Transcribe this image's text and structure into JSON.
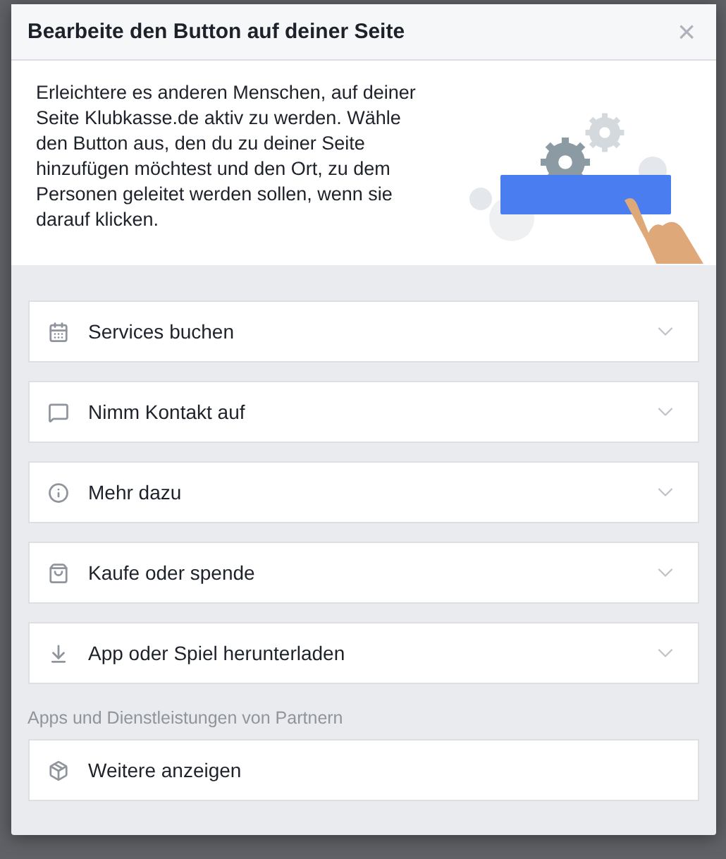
{
  "dialog": {
    "title": "Bearbeite den Button auf deiner Seite",
    "close": "×",
    "intro": "Erleichtere es anderen Menschen, auf deiner Seite Klubkasse.de aktiv zu werden. Wähle den Button aus, den du zu deiner Seite hinzufügen möchtest und den Ort, zu dem Personen geleitet werden sollen, wenn sie darauf klicken.",
    "options": [
      {
        "kind": "calendar",
        "label": "Services buchen",
        "expandable": true
      },
      {
        "kind": "chat",
        "label": "Nimm Kontakt auf",
        "expandable": true
      },
      {
        "kind": "info",
        "label": "Mehr dazu",
        "expandable": true
      },
      {
        "kind": "bag",
        "label": "Kaufe oder spende",
        "expandable": true
      },
      {
        "kind": "download",
        "label": "App oder Spiel herunterladen",
        "expandable": true
      }
    ],
    "partner_section": {
      "heading": "Apps und Dienstleistungen von Partnern",
      "items": [
        {
          "kind": "cube",
          "label": "Weitere anzeigen",
          "expandable": false
        }
      ]
    }
  }
}
